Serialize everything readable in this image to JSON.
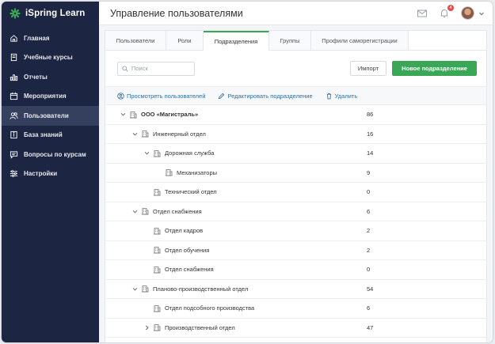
{
  "app": {
    "name": "iSpring Learn"
  },
  "sidebar": {
    "items": [
      {
        "label": "Главная",
        "icon": "home-icon"
      },
      {
        "label": "Учебные курсы",
        "icon": "book-icon"
      },
      {
        "label": "Отчеты",
        "icon": "bar-chart-icon"
      },
      {
        "label": "Мероприятия",
        "icon": "calendar-icon"
      },
      {
        "label": "Пользователи",
        "icon": "users-icon",
        "active": true
      },
      {
        "label": "База знаний",
        "icon": "knowledge-icon"
      },
      {
        "label": "Вопросы по курсам",
        "icon": "chat-icon"
      },
      {
        "label": "Настройки",
        "icon": "sliders-icon"
      }
    ]
  },
  "header": {
    "title": "Управление пользователями",
    "notifications_count": "4"
  },
  "tabs": [
    {
      "label": "Пользователи"
    },
    {
      "label": "Роли"
    },
    {
      "label": "Подразделения",
      "active": true
    },
    {
      "label": "Группы"
    },
    {
      "label": "Профили саморегистрации"
    }
  ],
  "search": {
    "placeholder": "Поиск",
    "value": ""
  },
  "buttons": {
    "import": "Импорт",
    "new_department": "Новое подразделение"
  },
  "toolbar": {
    "view_users": "Просмотреть пользователей",
    "edit_department": "Редактировать подразделение",
    "delete": "Удалить"
  },
  "tree": [
    {
      "name": "ООО «Магистраль»",
      "count": "86",
      "level": 0,
      "expanded": true,
      "bold": true
    },
    {
      "name": "Инженерный отдел",
      "count": "16",
      "level": 1,
      "expanded": true
    },
    {
      "name": "Дорожная служба",
      "count": "14",
      "level": 2,
      "expanded": true
    },
    {
      "name": "Механизаторы",
      "count": "9",
      "level": 3
    },
    {
      "name": "Технический отдел",
      "count": "0",
      "level": 2
    },
    {
      "name": "Отдел снабжения",
      "count": "6",
      "level": 1,
      "expanded": true
    },
    {
      "name": "Отдел кадров",
      "count": "2",
      "level": 2
    },
    {
      "name": "Отдел обучения",
      "count": "2",
      "level": 2
    },
    {
      "name": "Отдел снабжения",
      "count": "0",
      "level": 2
    },
    {
      "name": "Планово-производственный отдел",
      "count": "54",
      "level": 1,
      "expanded": true
    },
    {
      "name": "Отдел подсобного производства",
      "count": "6",
      "level": 2
    },
    {
      "name": "Производственный отдел",
      "count": "47",
      "level": 2,
      "expanded": false,
      "has_children": true
    }
  ],
  "colors": {
    "sidebar": "#1c2541",
    "accent": "#3aa757",
    "link": "#2f6f9f"
  }
}
